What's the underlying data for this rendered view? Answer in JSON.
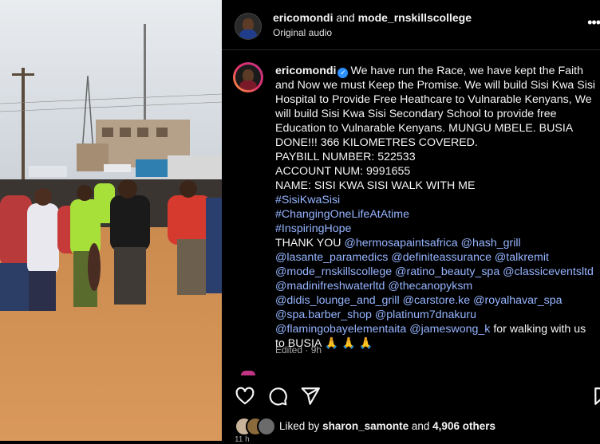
{
  "post": {
    "author": "ericomondi",
    "coauthor": "mode_rnskillscollege",
    "joiner": "and",
    "audio": "Original audio",
    "more_icon": "more-horizontal-icon"
  },
  "caption": {
    "username": "ericomondi",
    "text": "We have run the Race, we have kept the Faith and Now we must Keep the Promise. We will build Sisi Kwa Sisi Hospital to Provide Free Heathcare to Vulnarable Kenyans, We will build Sisi Kwa Sisi Secondary School to provide free Education to Vulnarable Kenyans. MUNGU MBELE. BUSIA DONE!!! 366 KILOMETRES COVERED.",
    "paybill": "PAYBILL NUMBER: 522533",
    "account": "ACCOUNT NUM: 9991655",
    "name_line": "NAME: SISI KWA SISI WALK WITH ME",
    "hashtags": [
      "#SisiKwaSisi",
      "#ChangingOneLifeAtAtime",
      "#InspiringHope"
    ],
    "thanks_prefix": "THANK YOU",
    "mentions": [
      "@hermosapaintsafrica",
      "@hash_grill",
      "@lasante_paramedics",
      "@definiteassurance",
      "@talkremit",
      "@mode_rnskillscollege",
      "@ratino_beauty_spa",
      "@classiceventsltd",
      "@madinifreshwaterltd",
      "@thecanopyksm",
      "@didis_lounge_and_grill",
      "@carstore.ke",
      "@royalhavar_spa",
      "@spa.barber_shop",
      "@platinum7dnakuru",
      "@flamingobayelementaita",
      "@jameswong_k"
    ],
    "closing": "for walking with us to BUSIA 🙏 🙏 🙏",
    "edited": "Edited · 9h"
  },
  "likes": {
    "prefix": "Liked by",
    "user": "sharon_samonte",
    "middle": "and",
    "others": "4,906 others"
  },
  "date_peek": "11 h",
  "colors": {
    "link": "#95b4ff",
    "verified": "#2b8fff",
    "background": "#000000"
  }
}
